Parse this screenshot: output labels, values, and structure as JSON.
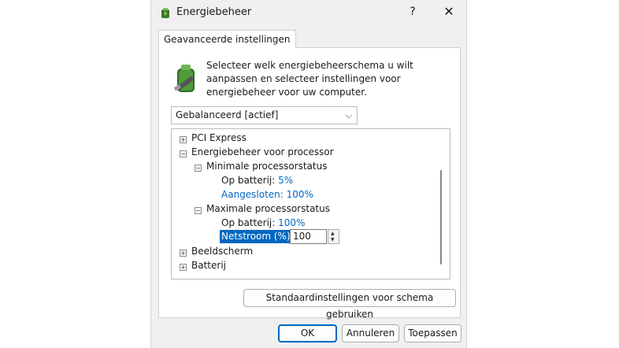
{
  "window": {
    "title": "Energiebeheer",
    "help": "?",
    "close": "✕"
  },
  "tab": {
    "label": "Geavanceerde instellingen"
  },
  "description": "Selecteer welk energiebeheerschema u wilt aanpassen en selecteer instellingen voor energiebeheer voor uw computer.",
  "plan_select": {
    "value": "Gebalanceerd [actief]"
  },
  "tree": {
    "pci_express": "PCI Express",
    "processor": "Energiebeheer voor processor",
    "min_status": "Minimale processorstatus",
    "min_battery_label": "Op batterij:",
    "min_battery_value": "5%",
    "min_plugged": "Aangesloten: 100%",
    "max_status": "Maximale processorstatus",
    "max_battery_label": "Op batterij:",
    "max_battery_value": "100%",
    "max_ac_label": "Netstroom (%):",
    "max_ac_value": "100",
    "display": "Beeldscherm",
    "battery": "Batterij"
  },
  "buttons": {
    "restore_defaults": "Standaardinstellingen voor schema gebruiken",
    "ok": "OK",
    "cancel": "Annuleren",
    "apply": "Toepassen"
  },
  "colors": {
    "accent": "#0067c0",
    "background": "#f0f0f0"
  }
}
